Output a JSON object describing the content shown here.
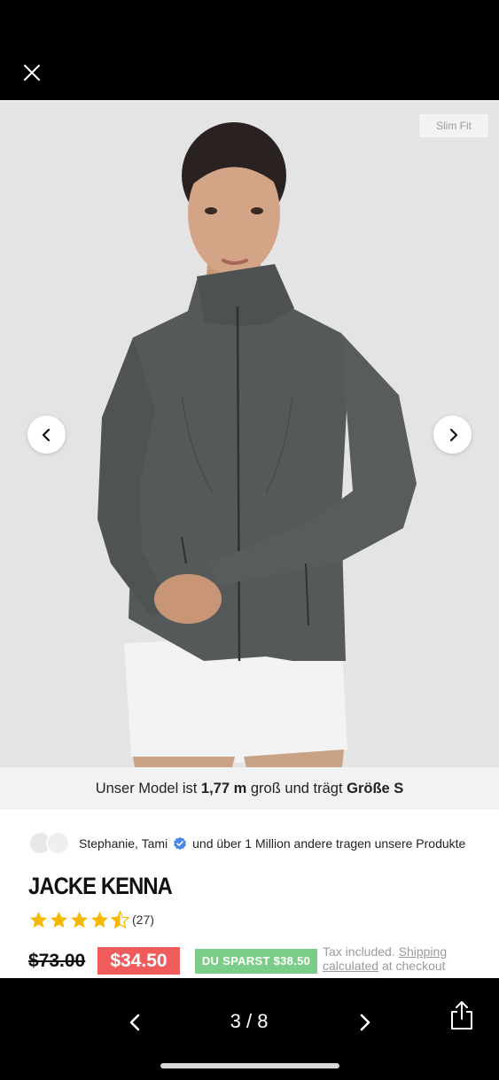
{
  "viewer": {
    "close_icon": "close-icon",
    "page_current": "3",
    "page_separator": "/",
    "page_total": "8",
    "prev_icon": "chevron-left-icon",
    "next_icon": "chevron-right-icon",
    "share_icon": "share-icon"
  },
  "gallery": {
    "fit_badge": "Slim Fit",
    "prev_icon": "chevron-left-icon",
    "next_icon": "chevron-right-icon",
    "jacket_color": "#55595a",
    "background_color": "#e4e4e4"
  },
  "model_info": {
    "prefix": "Unser Model ist ",
    "height": "1,77 m",
    "middle": " groß und trägt ",
    "size": "Größe S"
  },
  "social_proof": {
    "names": "Stephanie, Tami",
    "verified_icon": "verified-badge-icon",
    "rest": "und über 1 Million andere tragen unsere Produkte"
  },
  "product": {
    "title": "JACKE KENNA",
    "rating": 4.5,
    "review_count": "(27)",
    "old_price": "$73.00",
    "new_price": "$34.50",
    "savings": "DU SPARST $38.50",
    "tax_text": "Tax included.",
    "shipping_link": "Shipping calculated",
    "checkout_text": "at checkout"
  },
  "colors": {
    "sale_red": "#f05b5b",
    "savings_green": "#7ccd87",
    "star_gold": "#f5b800"
  }
}
